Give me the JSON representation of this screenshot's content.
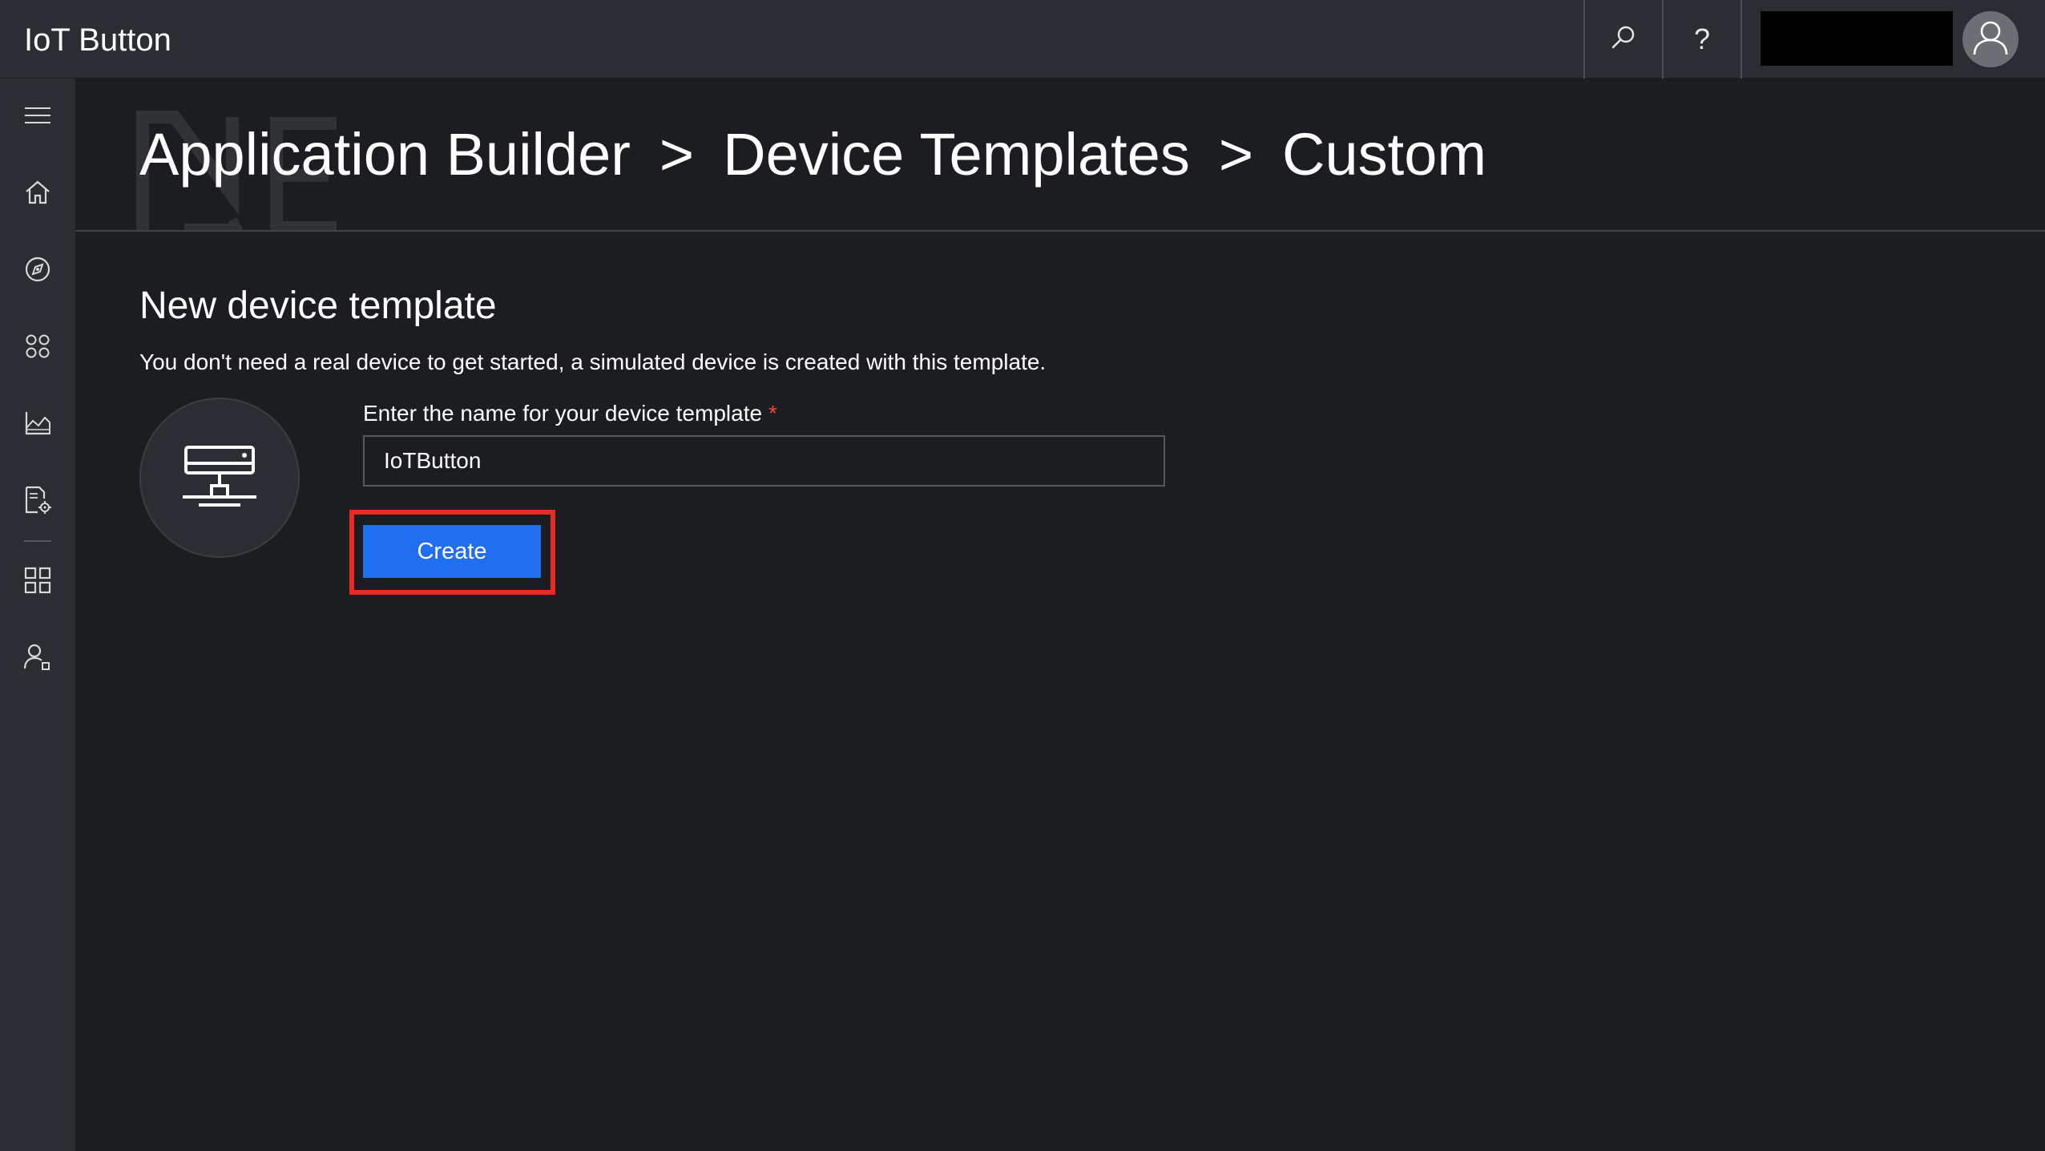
{
  "app": {
    "title": "IoT Button"
  },
  "topbar": {
    "search_icon": "search-icon",
    "help_glyph": "?",
    "help_icon": "help-icon",
    "account_name": "",
    "avatar_icon": "user-icon"
  },
  "sidebar": {
    "items": [
      {
        "id": "menu",
        "icon": "hamburger-menu-icon"
      },
      {
        "id": "home",
        "icon": "home-icon"
      },
      {
        "id": "explorer",
        "icon": "compass-icon"
      },
      {
        "id": "device-sets",
        "icon": "device-sets-icon"
      },
      {
        "id": "analytics",
        "icon": "analytics-chart-icon"
      },
      {
        "id": "jobs",
        "icon": "document-gear-icon"
      },
      {
        "id": "application-builder",
        "icon": "grid-apps-icon"
      },
      {
        "id": "administration",
        "icon": "user-settings-icon"
      }
    ]
  },
  "breadcrumb": {
    "items": [
      "Application Builder",
      "Device Templates",
      "Custom"
    ],
    "separator": ">"
  },
  "main": {
    "title": "New device template",
    "description": "You don't need a real device to get started, a simulated device is created with this template.",
    "device_icon": "device-icon",
    "name_field": {
      "label": "Enter the name for your device template",
      "required_marker": "*",
      "value": "IoTButton"
    },
    "create_button": {
      "label": "Create"
    }
  },
  "colors": {
    "topbar_bg": "#2a2d31",
    "page_bg": "#1b1d20",
    "accent": "#1f6ff0",
    "highlight": "#e82a22",
    "required": "#e8453c"
  }
}
